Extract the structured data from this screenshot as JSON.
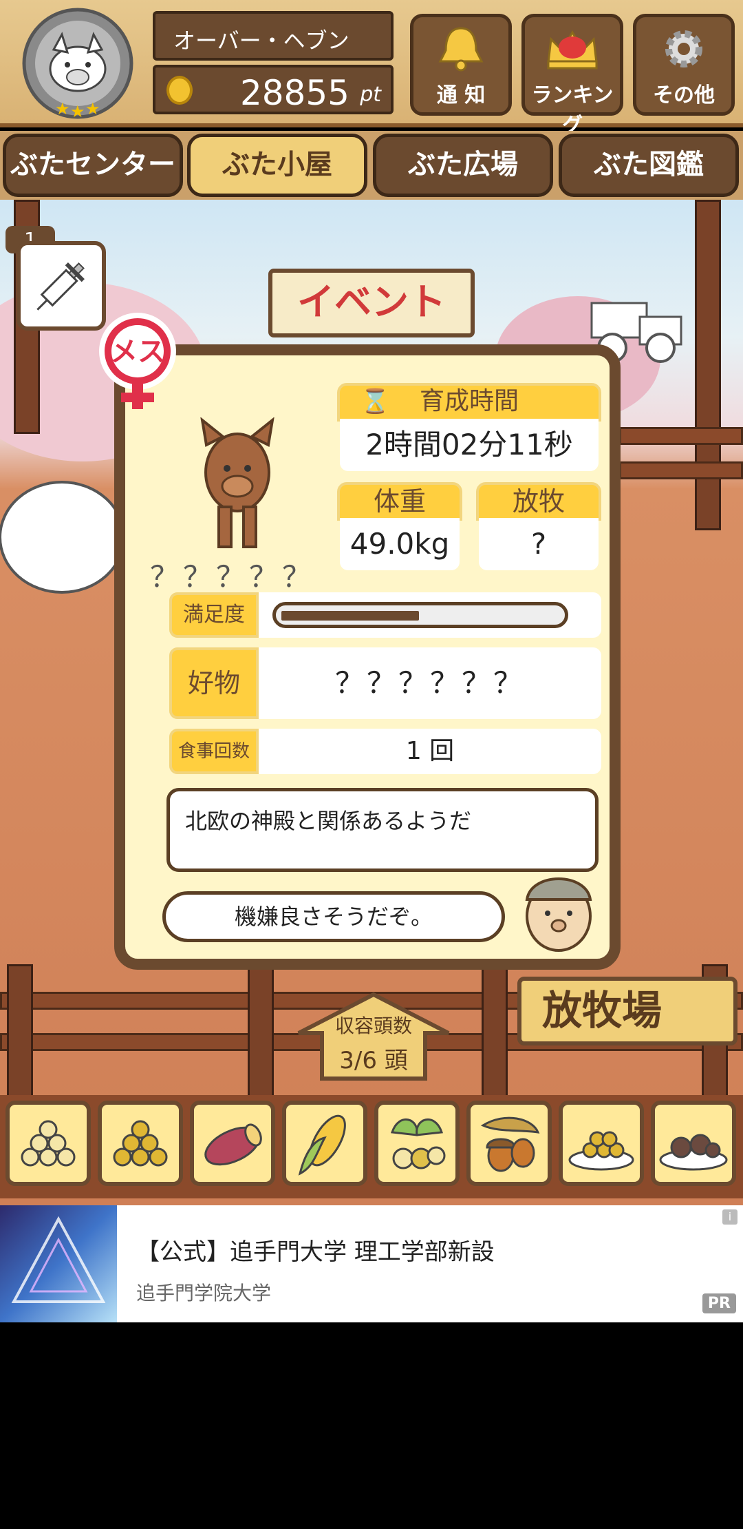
{
  "header": {
    "player_name": "オーバー・ヘブン",
    "points": "28855",
    "points_unit": "pt",
    "buttons": [
      {
        "label": "通 知",
        "icon": "bell-icon"
      },
      {
        "label": "ランキング",
        "icon": "crown-icon"
      },
      {
        "label": "その他",
        "icon": "gear-icon"
      }
    ]
  },
  "tabs": [
    {
      "label": "ぶたセンター",
      "active": false
    },
    {
      "label": "ぶた小屋",
      "active": true
    },
    {
      "label": "ぶた広場",
      "active": false
    },
    {
      "label": "ぶた図鑑",
      "active": false
    }
  ],
  "scene": {
    "vial_count": "1",
    "event_sign": "イベント"
  },
  "pig_card": {
    "gender": "メス",
    "name": "？？？？？",
    "growth_time_label": "育成時間",
    "growth_time_value": "2時間02分11秒",
    "weight_label": "体重",
    "weight_value": "49.0kg",
    "grazing_label": "放牧",
    "grazing_value": "?",
    "satisfaction_label": "満足度",
    "satisfaction_level": 0.5,
    "favorite_label": "好物",
    "favorite_value": "？？？？？？",
    "meals_label": "食事回数",
    "meals_value": "1 回",
    "hint_text": "北欧の神殿と関係あるようだ",
    "farmer_comment": "機嫌良さそうだぞ。"
  },
  "capacity": {
    "label": "収容頭数",
    "value": "3/6 頭"
  },
  "pasture_sign": "放牧場",
  "food_items": [
    {
      "name": "soybeans-icon"
    },
    {
      "name": "yellow-beans-icon"
    },
    {
      "name": "sweet-potato-icon"
    },
    {
      "name": "corn-icon"
    },
    {
      "name": "ginkgo-nuts-icon"
    },
    {
      "name": "acorn-icon"
    },
    {
      "name": "bean-plate-icon"
    },
    {
      "name": "meat-dish-icon"
    }
  ],
  "ad": {
    "title": "【公式】追手門大学 理工学部新設",
    "sponsor": "追手門学院大学",
    "badge": "PR",
    "info": "i"
  },
  "colors": {
    "wood_dark": "#6b4a2f",
    "wood_light": "#e7c98f",
    "card_bg": "#fff6c9",
    "label_yellow": "#ffcf3f",
    "gender_red": "#e0304a"
  }
}
